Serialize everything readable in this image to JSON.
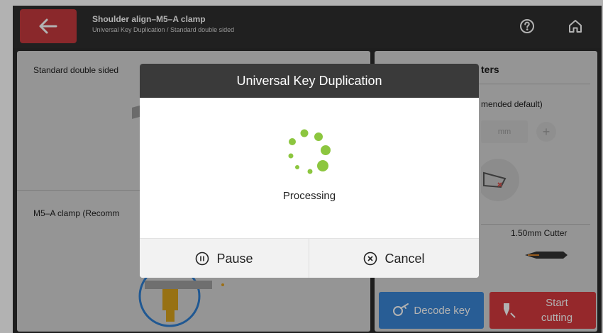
{
  "header": {
    "title": "Shoulder align–M5–A clamp",
    "breadcrumb": "Universal Key Duplication / Standard double sided",
    "back_icon": "arrow-left-icon",
    "help_icon": "help-icon",
    "home_icon": "home-icon"
  },
  "left_panel": {
    "key_type_label": "Standard double sided",
    "clamp_label": "M5–A clamp (Recomm"
  },
  "right_panel": {
    "section_title": "ters",
    "recommended_label": "mended default)",
    "depth_unit": "mm",
    "plus_symbol": "+",
    "cutter_label": "1.50mm Cutter"
  },
  "actions": {
    "decode_label": "Decode key",
    "start_label_line1": "Start",
    "start_label_line2": "cutting"
  },
  "modal": {
    "title": "Universal Key Duplication",
    "status": "Processing",
    "pause_label": "Pause",
    "cancel_label": "Cancel"
  },
  "colors": {
    "back_button": "#c63a3e",
    "decode_button": "#3a86d6",
    "start_button": "#d63a3e",
    "spinner": "#8cc63f",
    "header_bg": "#2f2f2f",
    "modal_header": "#3a3a3a"
  }
}
